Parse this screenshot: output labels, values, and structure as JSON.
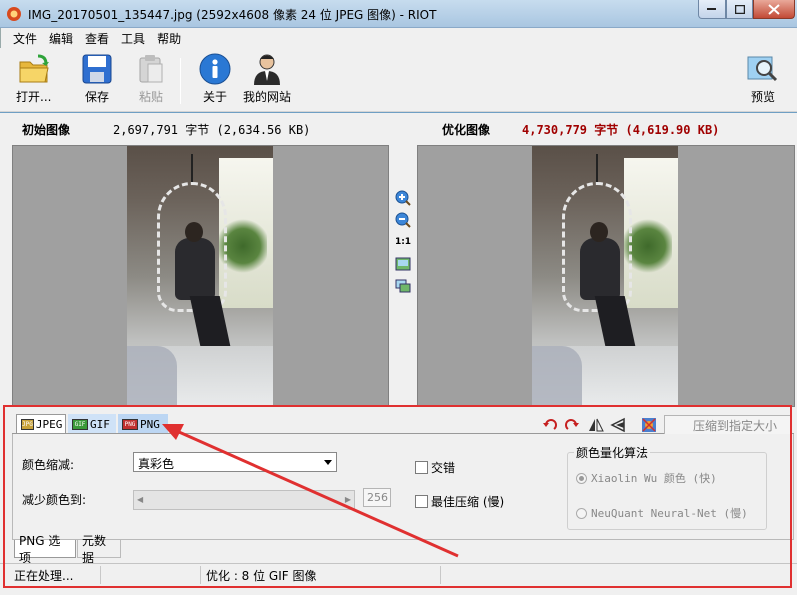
{
  "window": {
    "title": "IMG_20170501_135447.jpg (2592x4608 像素 24 位 JPEG 图像) - RIOT"
  },
  "menu": [
    "文件",
    "编辑",
    "查看",
    "工具",
    "帮助"
  ],
  "toolbar": {
    "open": "打开...",
    "save": "保存",
    "paste": "粘贴",
    "about": "关于",
    "website": "我的网站",
    "preview": "预览"
  },
  "info": {
    "original_label": "初始图像",
    "original_size": "2,697,791 字节 (2,634.56 KB)",
    "optimized_label": "优化图像",
    "optimized_size": "4,730,779 字节 (4,619.90 KB)"
  },
  "zoom": {
    "one_to_one": "1:1"
  },
  "format_tabs": [
    "JPEG",
    "GIF",
    "PNG"
  ],
  "compress_button": "压缩到指定大小",
  "png_options": {
    "color_reduction_label": "颜色缩减:",
    "color_reduction_value": "真彩色",
    "reduce_colors_label": "减少颜色到:",
    "reduce_colors_value": "256",
    "interlaced_label": "交错",
    "best_compression_label": "最佳压缩 (慢)",
    "quant_group_title": "颜色量化算法",
    "quant_options": [
      "Xiaolin Wu 颜色 (快)",
      "NeuQuant Neural-Net (慢)"
    ]
  },
  "sub_tabs": [
    "PNG 选项",
    "元数据"
  ],
  "status": {
    "left": "正在处理...",
    "right": "优化 : 8 位 GIF 图像"
  },
  "colors": {
    "highlight_box": "#e03030",
    "optimized_size": "#a00000"
  }
}
